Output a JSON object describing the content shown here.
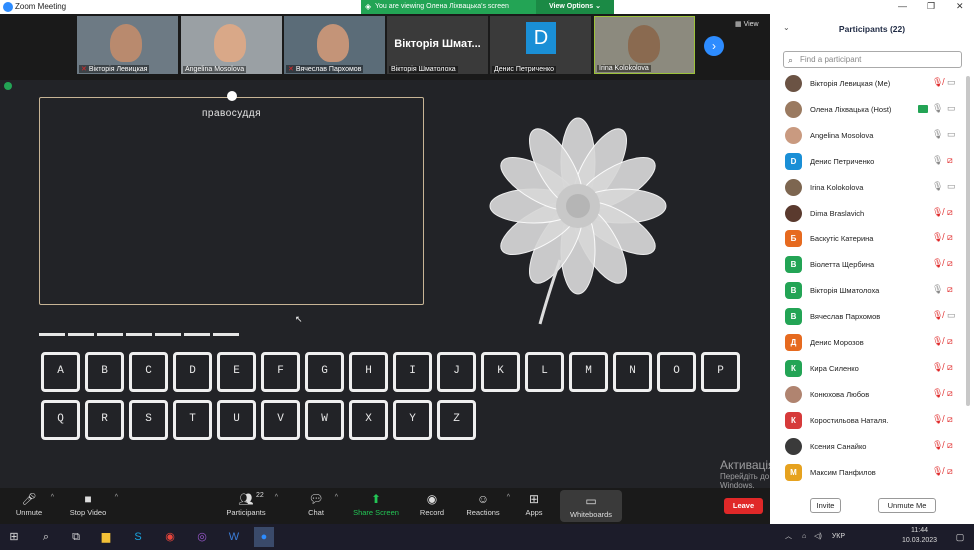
{
  "window": {
    "title": "Zoom Meeting"
  },
  "share_banner": {
    "text": "You are viewing Олена Ліхвацька's screen",
    "view_options": "View Options ⌄"
  },
  "gallery": {
    "view_label": "View",
    "tiles": [
      {
        "name": "Вікторія Левицкая",
        "muted": true,
        "type": "video"
      },
      {
        "name": "Angelina Mosolova",
        "muted": false,
        "type": "video"
      },
      {
        "name": "Вячеслав Пархомов",
        "muted": true,
        "type": "video"
      },
      {
        "name": "Вікторія Шматолоха",
        "muted": false,
        "type": "name",
        "big": "Вікторія Шмат..."
      },
      {
        "name": "Денис Петриченко",
        "muted": false,
        "type": "letter",
        "big": "D"
      },
      {
        "name": "Irina Kolokolova",
        "muted": false,
        "type": "video"
      }
    ]
  },
  "whiteboard": {
    "word": "правосуддя",
    "dash_count": 7,
    "row1": [
      "A",
      "B",
      "C",
      "D",
      "E",
      "F",
      "G",
      "H",
      "I",
      "J",
      "K",
      "L",
      "M",
      "N",
      "O",
      "P"
    ],
    "row2": [
      "Q",
      "R",
      "S",
      "T",
      "U",
      "V",
      "W",
      "X",
      "Y",
      "Z"
    ]
  },
  "toolbar": {
    "unmute": "Unmute",
    "stop_video": "Stop Video",
    "participants": "Participants",
    "participants_count": "22",
    "chat": "Chat",
    "share_screen": "Share Screen",
    "record": "Record",
    "reactions": "Reactions",
    "apps": "Apps",
    "whiteboards": "Whiteboards",
    "leave": "Leave"
  },
  "watermark": {
    "line1": "Активація Windows",
    "line2": "Перейдіть до розділу \"Настройки\", щоб активувати",
    "line3": "Windows."
  },
  "panel": {
    "title": "Participants (22)",
    "search_placeholder": "Find a participant",
    "participants": [
      {
        "name": "Вікторія Левицкая (Me)",
        "av": "photo",
        "color": "#6b5344",
        "letter": "",
        "mic": "muted",
        "cam": "on"
      },
      {
        "name": "Олена Ліхвацька (Host)",
        "av": "photo",
        "color": "#9a7a60",
        "letter": "",
        "mic": "sharing",
        "cam": "on"
      },
      {
        "name": "Angelina Mosolova",
        "av": "photo",
        "color": "#c99a80",
        "letter": "",
        "mic": "on",
        "cam": "on"
      },
      {
        "name": "Денис Петриченко",
        "av": "letter",
        "color": "#1a8fd6",
        "letter": "D",
        "mic": "on",
        "cam": "off"
      },
      {
        "name": "Irina Kolokolova",
        "av": "photo",
        "color": "#7d6650",
        "letter": "",
        "mic": "on",
        "cam": "on"
      },
      {
        "name": "Dima Braslavich",
        "av": "photo",
        "color": "#5a3a2e",
        "letter": "",
        "mic": "muted",
        "cam": "off"
      },
      {
        "name": "Баскутіс Катерина",
        "av": "letter",
        "color": "#e66a1f",
        "letter": "Б",
        "mic": "muted",
        "cam": "off"
      },
      {
        "name": "Віолетта Щербина",
        "av": "letter",
        "color": "#23a455",
        "letter": "В",
        "mic": "muted",
        "cam": "off"
      },
      {
        "name": "Вікторія Шматолоха",
        "av": "letter",
        "color": "#23a455",
        "letter": "В",
        "mic": "on",
        "cam": "off"
      },
      {
        "name": "Вячеслав Пархомов",
        "av": "letter",
        "color": "#23a455",
        "letter": "В",
        "mic": "muted",
        "cam": "on"
      },
      {
        "name": "Денис Морозов",
        "av": "letter",
        "color": "#e66a1f",
        "letter": "Д",
        "mic": "muted",
        "cam": "off"
      },
      {
        "name": "Кира Силенко",
        "av": "letter",
        "color": "#23a455",
        "letter": "К",
        "mic": "muted",
        "cam": "off"
      },
      {
        "name": "Конюхова Любов",
        "av": "photo",
        "color": "#b08470",
        "letter": "",
        "mic": "muted",
        "cam": "off"
      },
      {
        "name": "Коростильова Наталя.",
        "av": "letter",
        "color": "#d63a3a",
        "letter": "К",
        "mic": "muted",
        "cam": "off"
      },
      {
        "name": "Ксения Санайко",
        "av": "photo",
        "color": "#3a3a3a",
        "letter": "",
        "mic": "muted",
        "cam": "off"
      },
      {
        "name": "Максим Панфилов",
        "av": "letter",
        "color": "#e6a21f",
        "letter": "М",
        "mic": "muted",
        "cam": "off"
      }
    ],
    "invite": "Invite",
    "unmute_me": "Unmute Me"
  },
  "taskbar": {
    "lang": "УКР",
    "time": "11:44",
    "date": "10.03.2023"
  }
}
